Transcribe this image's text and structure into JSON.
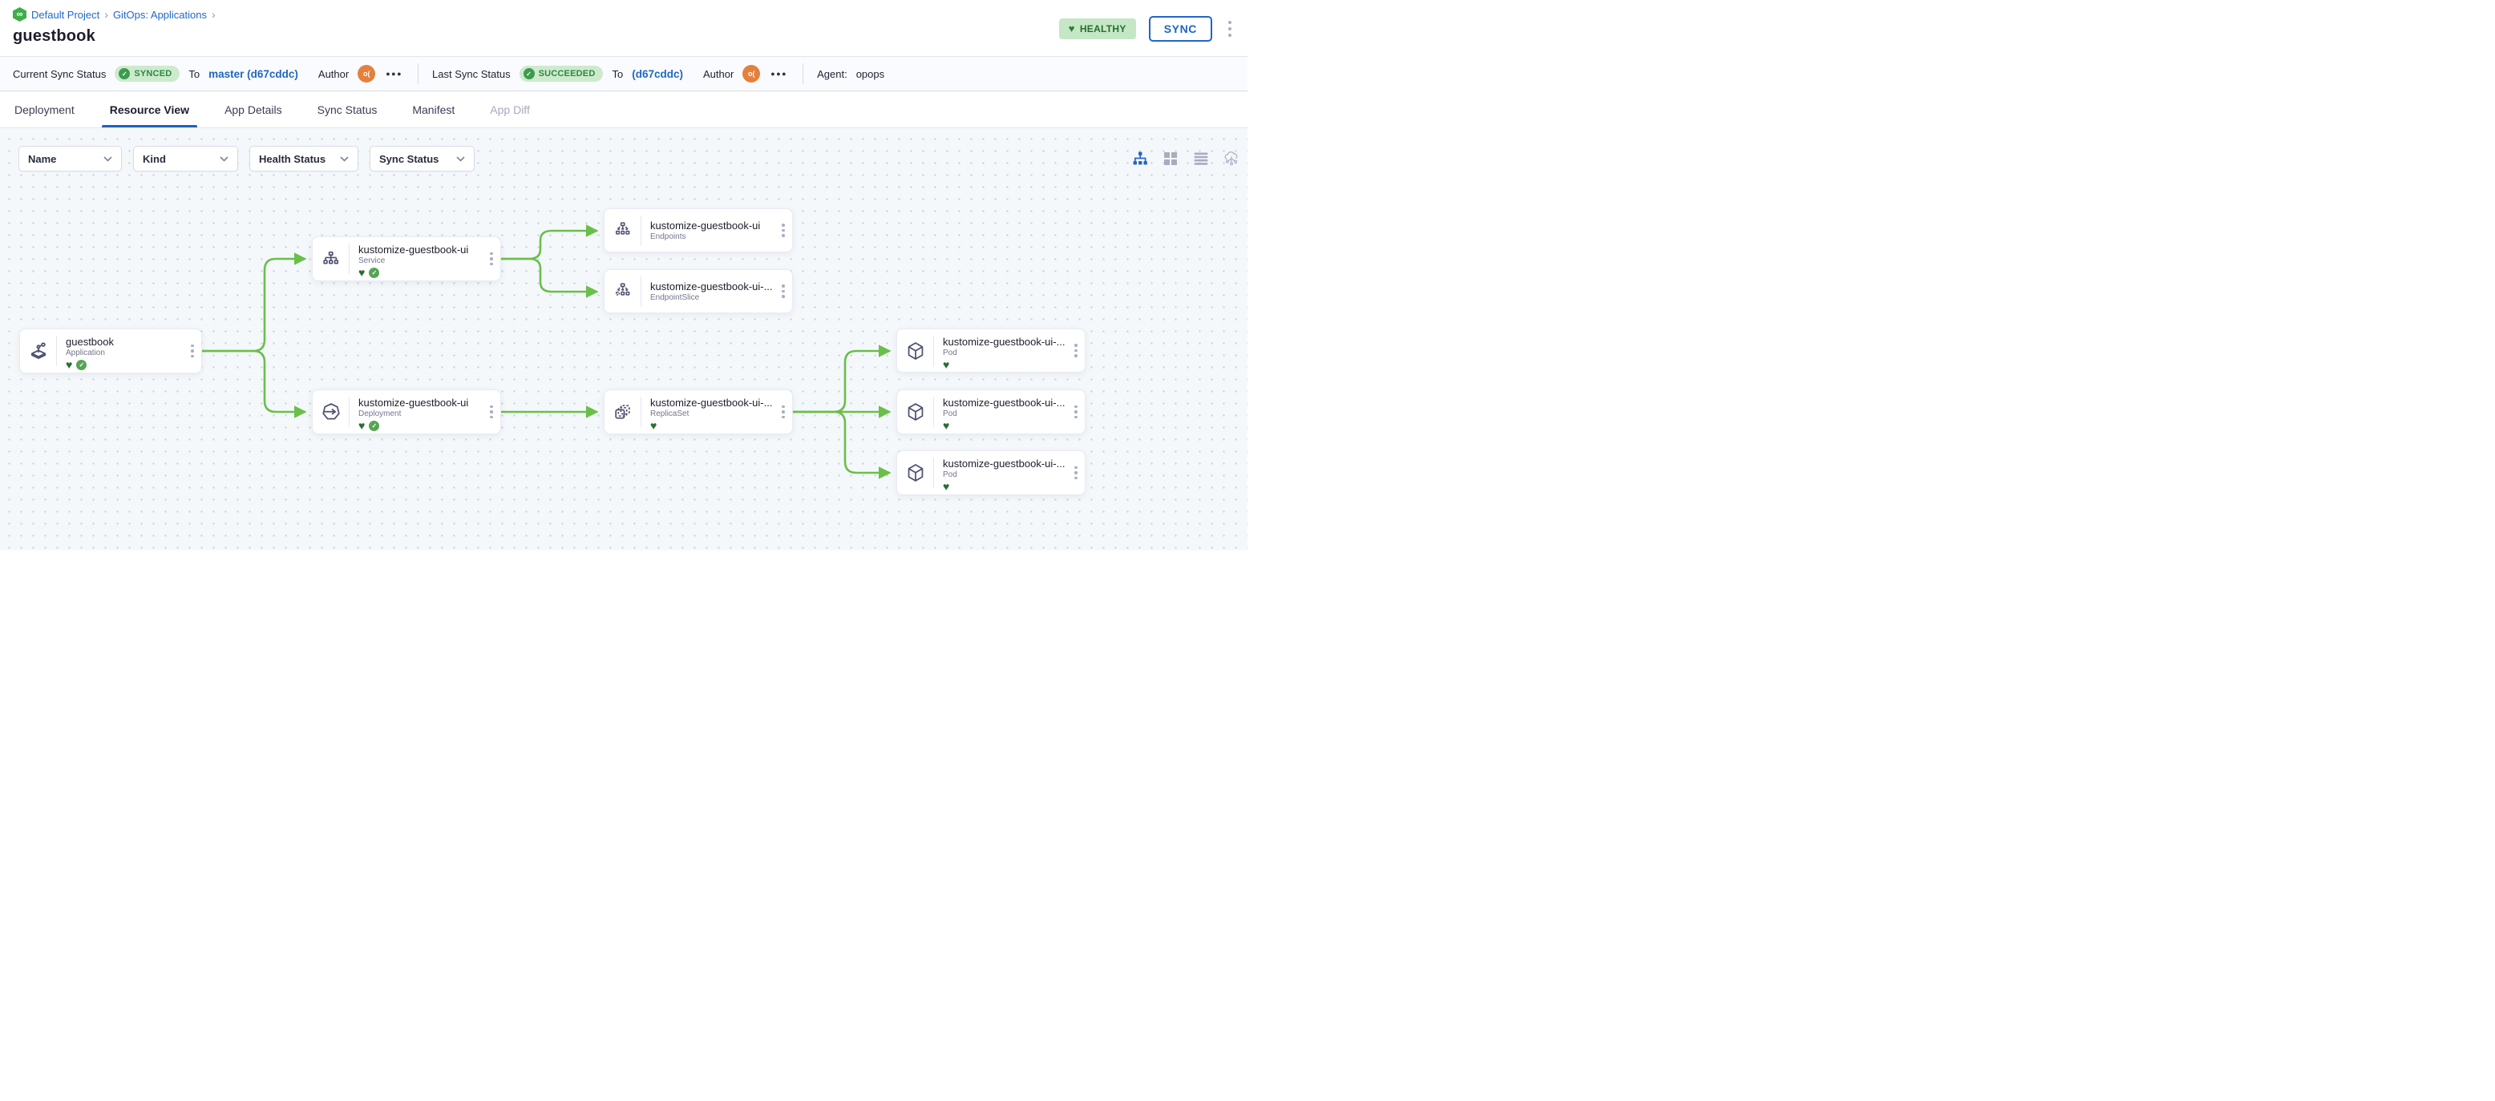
{
  "header": {
    "breadcrumb": {
      "project": "Default Project",
      "sep1": "›",
      "section": "GitOps: Applications",
      "sep2": "›"
    },
    "title": "guestbook",
    "health_badge": "HEALTHY",
    "sync_button": "SYNC"
  },
  "status_bar": {
    "current": {
      "label": "Current Sync Status",
      "badge": "SYNCED",
      "to_label": "To",
      "revision": "master (d67cddc)",
      "author_label": "Author",
      "avatar": "o(",
      "more": "●●●"
    },
    "last": {
      "label": "Last Sync Status",
      "badge": "SUCCEEDED",
      "to_label": "To",
      "revision": "(d67cddc)",
      "author_label": "Author",
      "avatar": "o(",
      "more": "●●●"
    },
    "agent_label": "Agent:",
    "agent_value": "opops"
  },
  "tabs": [
    {
      "label": "Deployment"
    },
    {
      "label": "Resource View"
    },
    {
      "label": "App Details"
    },
    {
      "label": "Sync Status"
    },
    {
      "label": "Manifest"
    },
    {
      "label": "App Diff"
    }
  ],
  "filters": [
    {
      "label": "Name"
    },
    {
      "label": "Kind"
    },
    {
      "label": "Health Status"
    },
    {
      "label": "Sync Status"
    }
  ],
  "view_toggles": [
    "tree-view",
    "grid-view",
    "list-view",
    "network-view"
  ],
  "canvas": {
    "nodes": [
      {
        "title": "guestbook",
        "kind": "Application",
        "healthy": true,
        "synced": true
      },
      {
        "title": "kustomize-guestbook-ui",
        "kind": "Service",
        "healthy": true,
        "synced": true
      },
      {
        "title": "kustomize-guestbook-ui",
        "kind": "Endpoints"
      },
      {
        "title": "kustomize-guestbook-ui-...",
        "kind": "EndpointSlice"
      },
      {
        "title": "kustomize-guestbook-ui",
        "kind": "Deployment",
        "healthy": true,
        "synced": true
      },
      {
        "title": "kustomize-guestbook-ui-...",
        "kind": "ReplicaSet",
        "healthy": true
      },
      {
        "title": "kustomize-guestbook-ui-...",
        "kind": "Pod",
        "healthy": true
      },
      {
        "title": "kustomize-guestbook-ui-...",
        "kind": "Pod",
        "healthy": true
      },
      {
        "title": "kustomize-guestbook-ui-...",
        "kind": "Pod",
        "healthy": true
      }
    ]
  },
  "colors": {
    "accent_blue": "#2066c8",
    "link_blue": "#1f68c1",
    "healthy_badge_bg": "#c5e7c6",
    "healthy_text": "#276c2e",
    "synced_badge_bg": "#cdeacd",
    "heart_green": "#2a6d30",
    "check_green": "#55a455",
    "edge_green": "#6abf4a",
    "avatar_orange": "#e5803c",
    "canvas_bg": "#f4f8fb"
  }
}
